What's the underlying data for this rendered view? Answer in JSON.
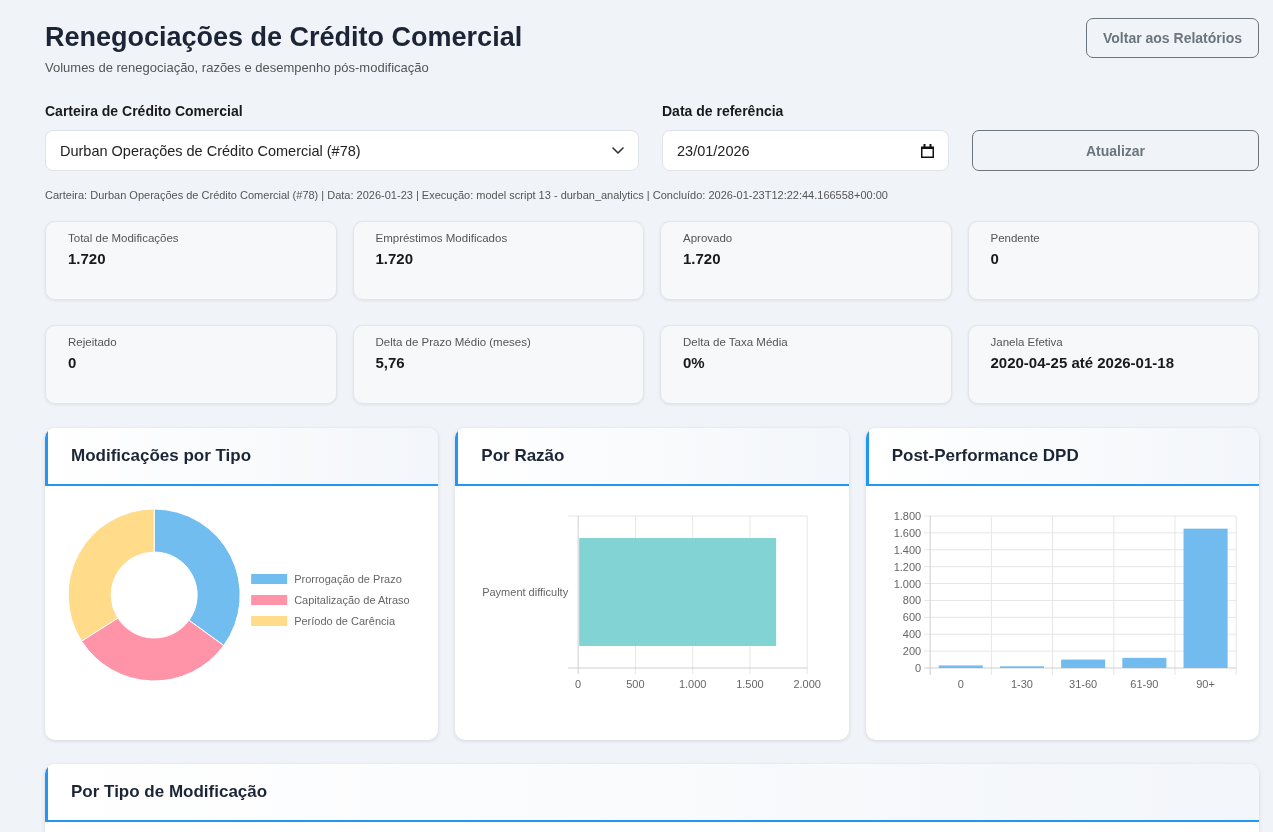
{
  "header": {
    "title": "Renegociações de Crédito Comercial",
    "subtitle": "Volumes de renegociação, razões e desempenho pós-modificação",
    "back_button": "Voltar aos Relatórios"
  },
  "filters": {
    "portfolio": {
      "label": "Carteira de Crédito Comercial",
      "value": "Durban Operações de Crédito Comercial (#78)"
    },
    "reference_date": {
      "label": "Data de referência",
      "value": "23/01/2026"
    },
    "refresh_button": "Atualizar"
  },
  "run_info": "Carteira: Durban Operações de Crédito Comercial (#78) | Data: 2026-01-23 | Execução: model script 13 - durban_analytics | Concluído: 2026-01-23T12:22:44.166558+00:00",
  "kpis": [
    {
      "label": "Total de Modificações",
      "value": "1.720"
    },
    {
      "label": "Empréstimos Modificados",
      "value": "1.720"
    },
    {
      "label": "Aprovado",
      "value": "1.720"
    },
    {
      "label": "Pendente",
      "value": "0"
    },
    {
      "label": "Rejeitado",
      "value": "0"
    },
    {
      "label": "Delta de Prazo Médio (meses)",
      "value": "5,76"
    },
    {
      "label": "Delta de Taxa Média",
      "value": "0%"
    },
    {
      "label": "Janela Efetiva",
      "value": "2020-04-25 até 2026-01-18"
    }
  ],
  "charts": [
    {
      "title": "Modificações por Tipo",
      "chart_data": {
        "type": "donut",
        "categories": [
          "Prorrogação de Prazo",
          "Capitalização de Atraso",
          "Período de Carência"
        ],
        "values": [
          35,
          31,
          34
        ],
        "colors": [
          "#72bdf0",
          "#ff94a9",
          "#ffdb8a"
        ],
        "legend": "right"
      }
    },
    {
      "title": "Por Razão",
      "chart_data": {
        "type": "bar",
        "orientation": "horizontal",
        "categories": [
          "Payment difficulty"
        ],
        "series": [
          {
            "color": "#82d3d3",
            "values": [
              1720
            ]
          }
        ],
        "xlim": [
          0,
          2000
        ],
        "xticks": [
          {
            "value": 0,
            "label": "0"
          },
          {
            "value": 500,
            "label": "500"
          },
          {
            "value": 1000,
            "label": "1.000"
          },
          {
            "value": 1500,
            "label": "1.500"
          },
          {
            "value": 2000,
            "label": "2.000"
          }
        ],
        "grid": true
      }
    },
    {
      "title": "Post-Performance DPD",
      "chart_data": {
        "type": "bar",
        "orientation": "vertical",
        "categories": [
          "0",
          "1-30",
          "31-60",
          "61-90",
          "90+"
        ],
        "series": [
          {
            "color": "#71bbef",
            "values": [
              30,
              20,
              100,
              120,
              1650
            ]
          }
        ],
        "ylim": [
          0,
          1800
        ],
        "yticks": [
          {
            "value": 0,
            "label": "0"
          },
          {
            "value": 200,
            "label": "200"
          },
          {
            "value": 400,
            "label": "400"
          },
          {
            "value": 600,
            "label": "600"
          },
          {
            "value": 800,
            "label": "800"
          },
          {
            "value": 1000,
            "label": "1.000"
          },
          {
            "value": 1200,
            "label": "1.200"
          },
          {
            "value": 1400,
            "label": "1.400"
          },
          {
            "value": 1600,
            "label": "1.600"
          },
          {
            "value": 1800,
            "label": "1.800"
          }
        ],
        "grid": true
      }
    }
  ],
  "sections": [
    {
      "title": "Por Tipo de Modificação"
    }
  ]
}
